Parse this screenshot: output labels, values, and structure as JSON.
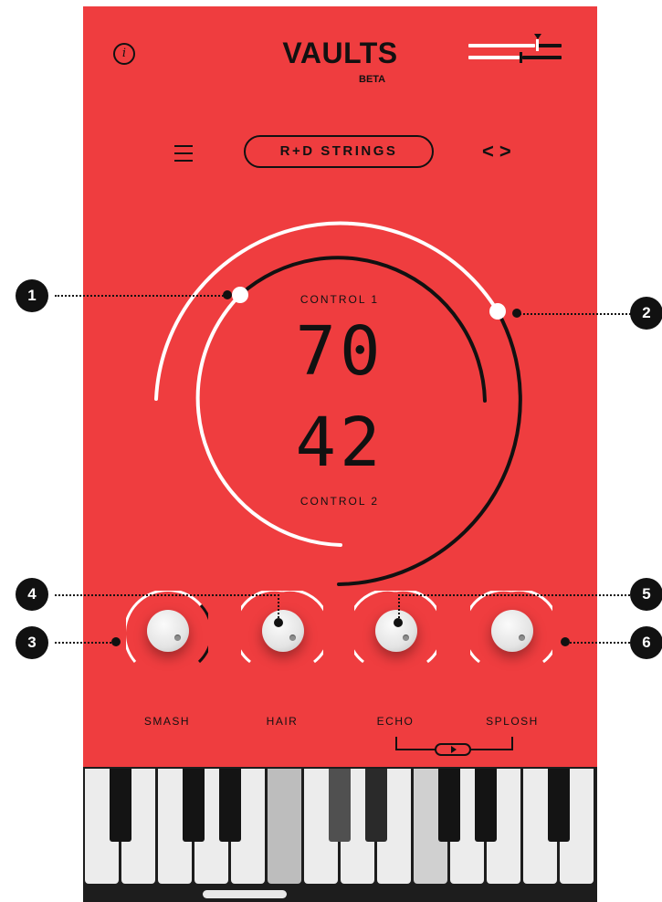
{
  "header": {
    "title": "VAULTS",
    "beta_label": "BETA",
    "info_icon": "info-icon",
    "slider_icon": "mixer-sliders-icon"
  },
  "preset": {
    "name": "R+D STRINGS",
    "menu_icon": "hamburger-icon",
    "prev_glyph": "<",
    "next_glyph": ">"
  },
  "dial": {
    "control1_label": "CONTROL 1",
    "control1_value": "70",
    "control2_label": "CONTROL 2",
    "control2_value": "42"
  },
  "knobs": [
    {
      "label": "SMASH"
    },
    {
      "label": "HAIR"
    },
    {
      "label": "ECHO"
    },
    {
      "label": "SPLOSH"
    }
  ],
  "callouts": [
    "1",
    "2",
    "3",
    "4",
    "5",
    "6"
  ],
  "keyboard": {
    "white_keys": 14,
    "pressed_white_key_indices": [
      5,
      9
    ],
    "pressed_black_key_indices": [
      3,
      4
    ]
  },
  "colors": {
    "background": "#ef3d3f",
    "ink": "#111111",
    "arc_white": "#ffffff",
    "key_white": "#ececec",
    "key_black": "#141414"
  }
}
